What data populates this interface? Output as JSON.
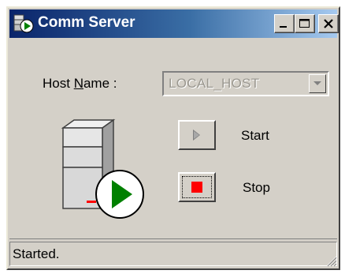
{
  "window": {
    "title": "Comm Server",
    "app_icon": "server-play-icon",
    "controls": [
      {
        "name": "minimize",
        "icon": "minimize-icon"
      },
      {
        "name": "maximize",
        "icon": "maximize-icon"
      },
      {
        "name": "close",
        "icon": "close-icon"
      }
    ]
  },
  "host": {
    "label_pre": "Host ",
    "label_accel": "N",
    "label_post": "ame :",
    "value": "LOCAL_HOST",
    "enabled": false
  },
  "actions": {
    "start_label": "Start",
    "stop_label": "Stop"
  },
  "status": {
    "text": "Started."
  },
  "colors": {
    "face": "#d4d0c8",
    "title_start": "#0a246a",
    "title_end": "#a6caf0",
    "play_green": "#008000",
    "stop_red": "#ff0000"
  }
}
